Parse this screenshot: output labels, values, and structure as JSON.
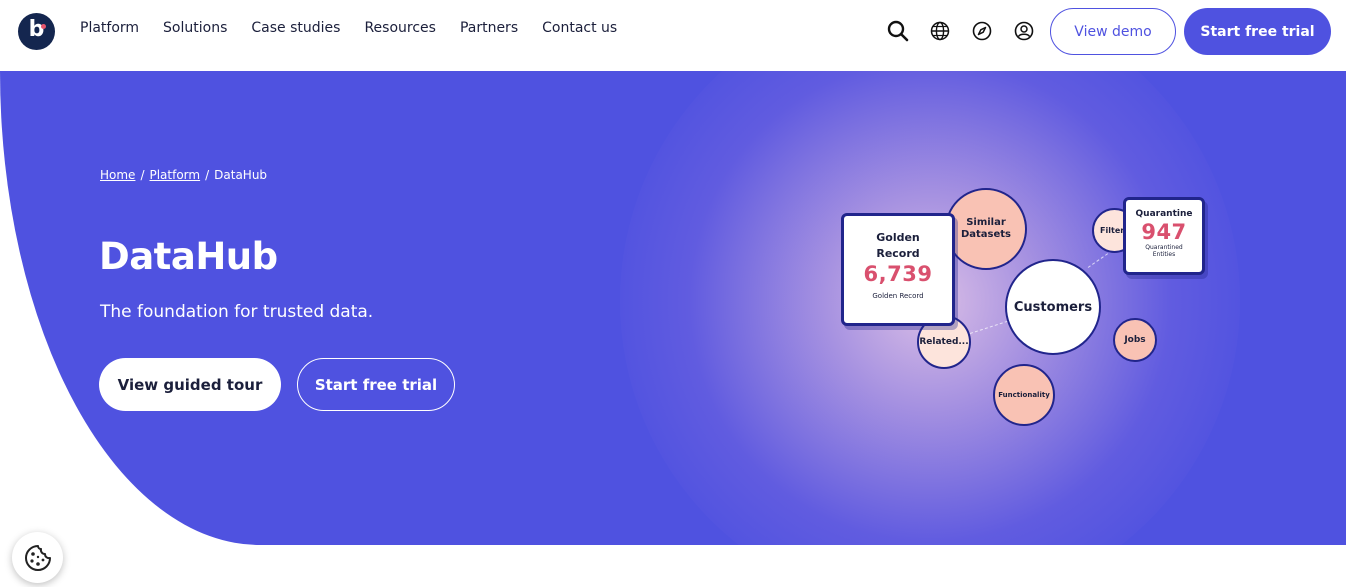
{
  "header": {
    "logo_letter": "b",
    "nav": [
      "Platform",
      "Solutions",
      "Case studies",
      "Resources",
      "Partners",
      "Contact us"
    ],
    "utility_icons": [
      "search-icon",
      "globe-icon",
      "compass-icon",
      "user-icon"
    ],
    "view_demo": "View demo",
    "start_trial": "Start free trial"
  },
  "hero": {
    "breadcrumb": {
      "home": "Home",
      "sep1": "/",
      "platform": "Platform",
      "sep2": "/",
      "current": "DataHub"
    },
    "title": "DataHub",
    "subtitle": "The foundation for trusted data.",
    "tour_button": "View guided tour",
    "trial_button": "Start free trial"
  },
  "illustration": {
    "golden_card": {
      "title": "Golden Record",
      "value": "6,739",
      "caption": "Golden Record"
    },
    "quarantine_card": {
      "title": "Quarantine",
      "value": "947",
      "caption": "Quarantined Entities"
    },
    "nodes": {
      "similar": "Similar Datasets",
      "customers": "Customers",
      "filters": "Filters",
      "jobs": "Jobs",
      "related": "Related...",
      "functionality": "Functionality"
    }
  },
  "colors": {
    "brand": "#4f52e0",
    "navy": "#21258c",
    "accent_value": "#d9506e",
    "peach": "#f9c2b4"
  },
  "cookie_icon": "cookie-icon"
}
